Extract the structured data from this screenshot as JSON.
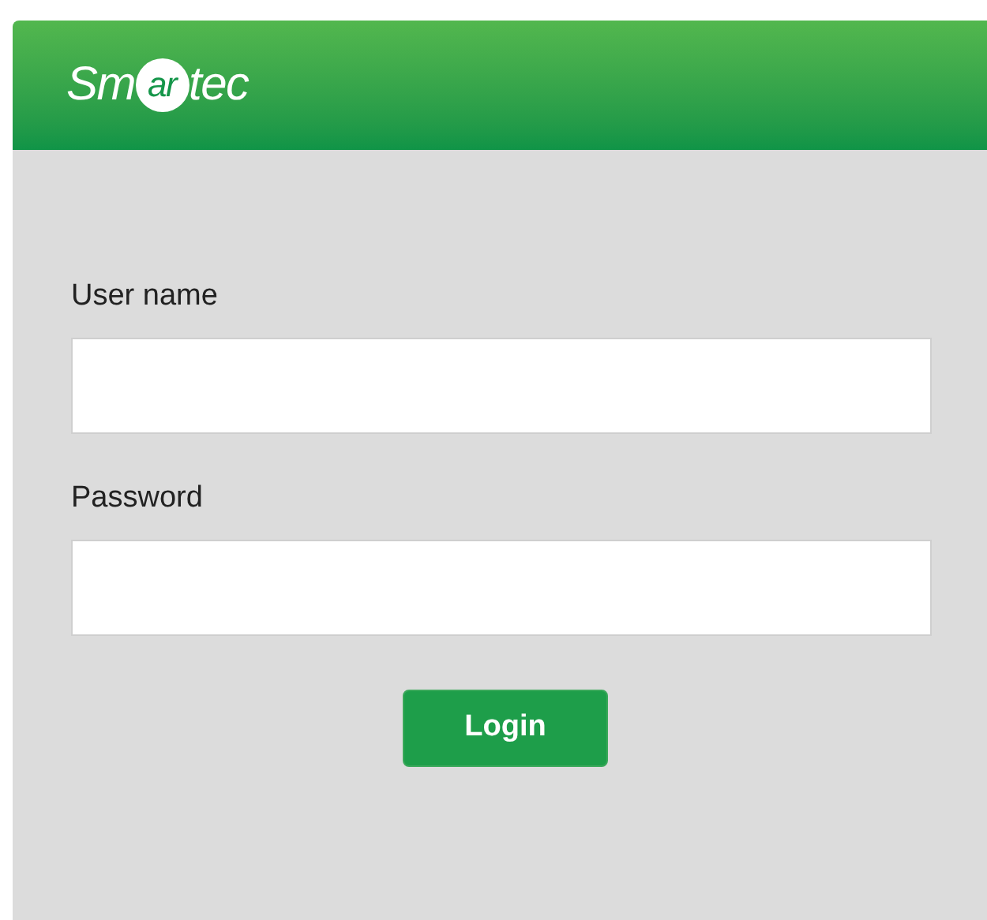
{
  "header": {
    "logo": {
      "before": "Sm",
      "circled": "ar",
      "after": "tec"
    }
  },
  "fields": [
    {
      "label": "User name"
    },
    {
      "label": "Password"
    }
  ],
  "login_button": "Login"
}
